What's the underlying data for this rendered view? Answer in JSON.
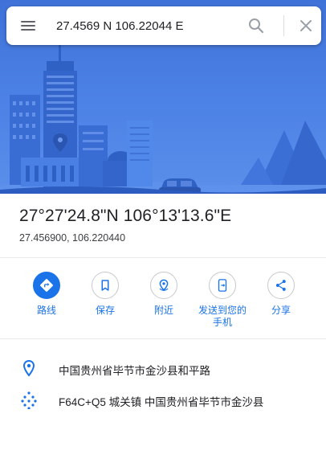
{
  "search": {
    "value": "27.4569 N 106.22044 E"
  },
  "place": {
    "title": "27°27'24.8\"N 106°13'13.6\"E",
    "decimal_coords": "27.456900, 106.220440"
  },
  "actions": [
    {
      "label": "路线",
      "icon": "directions-icon"
    },
    {
      "label": "保存",
      "icon": "bookmark-icon"
    },
    {
      "label": "附近",
      "icon": "nearby-icon"
    },
    {
      "label": "发送到您的\n手机",
      "icon": "send-to-phone-icon"
    },
    {
      "label": "分享",
      "icon": "share-icon"
    }
  ],
  "info": [
    {
      "text": "中国贵州省毕节市金沙县和平路",
      "icon": "location-pin-icon"
    },
    {
      "text": "F64C+Q5 城关镇 中国贵州省毕节市金沙县",
      "icon": "plus-code-icon"
    }
  ],
  "colors": {
    "accent": "#1a73e8",
    "hero_bg": "#4a7fe3",
    "text_primary": "#202124",
    "icon_grey": "#5f6368"
  }
}
